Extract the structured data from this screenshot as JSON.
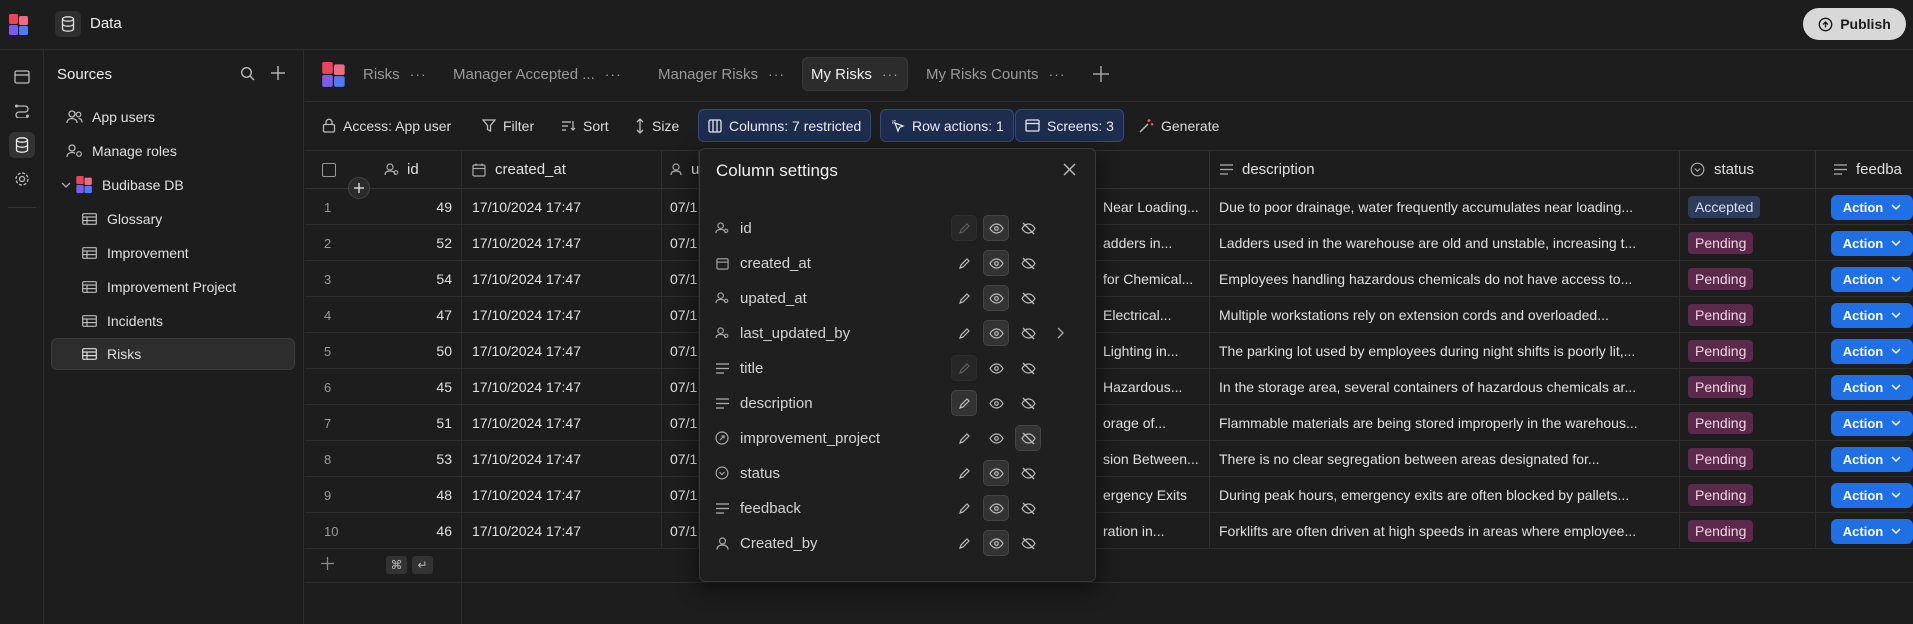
{
  "app": {
    "title": "Data",
    "publish_label": "Publish"
  },
  "sources": {
    "title": "Sources",
    "items": [
      {
        "label": "App users",
        "icon": "users-icon"
      },
      {
        "label": "Manage roles",
        "icon": "user-cog-icon"
      },
      {
        "label": "Budibase DB",
        "icon": "budibase-db-icon"
      },
      {
        "label": "Glossary",
        "icon": "table-icon"
      },
      {
        "label": "Improvement",
        "icon": "table-icon"
      },
      {
        "label": "Improvement Project",
        "icon": "table-icon"
      },
      {
        "label": "Incidents",
        "icon": "table-icon"
      },
      {
        "label": "Risks",
        "icon": "table-icon",
        "active": true
      }
    ]
  },
  "views": {
    "tabs": [
      {
        "label": "Risks"
      },
      {
        "label": "Manager Accepted ..."
      },
      {
        "label": "Manager Risks"
      },
      {
        "label": "My Risks",
        "active": true
      },
      {
        "label": "My Risks Counts"
      }
    ]
  },
  "toolbar": {
    "access": "Access: App user",
    "filter": "Filter",
    "sort": "Sort",
    "size": "Size",
    "columns": "Columns: 7 restricted",
    "row_actions": "Row actions: 1",
    "screens": "Screens: 3",
    "generate": "Generate"
  },
  "grid": {
    "columns": [
      "id",
      "created_at",
      "u",
      "description",
      "status",
      "feedba"
    ],
    "rows": [
      {
        "n": "1",
        "id": "49",
        "created_at": "17/10/2024 17:47",
        "u": "07/1",
        "title": "Near Loading...",
        "description": "Due to poor drainage, water frequently accumulates near loading...",
        "status": "Accepted"
      },
      {
        "n": "2",
        "id": "52",
        "created_at": "17/10/2024 17:47",
        "u": "07/1",
        "title": "adders in...",
        "description": "Ladders used in the warehouse are old and unstable, increasing t...",
        "status": "Pending"
      },
      {
        "n": "3",
        "id": "54",
        "created_at": "17/10/2024 17:47",
        "u": "07/1",
        "title": "for Chemical...",
        "description": "Employees handling hazardous chemicals do not have access to...",
        "status": "Pending"
      },
      {
        "n": "4",
        "id": "47",
        "created_at": "17/10/2024 17:47",
        "u": "07/1",
        "title": "Electrical...",
        "description": "Multiple workstations rely on extension cords and overloaded...",
        "status": "Pending"
      },
      {
        "n": "5",
        "id": "50",
        "created_at": "17/10/2024 17:47",
        "u": "07/1",
        "title": "Lighting in...",
        "description": "The parking lot used by employees during night shifts is poorly lit,...",
        "status": "Pending"
      },
      {
        "n": "6",
        "id": "45",
        "created_at": "17/10/2024 17:47",
        "u": "07/1",
        "title": "Hazardous...",
        "description": "In the storage area, several containers of hazardous chemicals ar...",
        "status": "Pending"
      },
      {
        "n": "7",
        "id": "51",
        "created_at": "17/10/2024 17:47",
        "u": "07/1",
        "title": "orage of...",
        "description": "Flammable materials are being stored improperly in the warehous...",
        "status": "Pending"
      },
      {
        "n": "8",
        "id": "53",
        "created_at": "17/10/2024 17:47",
        "u": "07/1",
        "title": "sion Between...",
        "description": "There is no clear segregation between areas designated for...",
        "status": "Pending"
      },
      {
        "n": "9",
        "id": "48",
        "created_at": "17/10/2024 17:47",
        "u": "07/1",
        "title": "ergency Exits",
        "description": "During peak hours, emergency exits are often blocked by pallets...",
        "status": "Pending"
      },
      {
        "n": "10",
        "id": "46",
        "created_at": "17/10/2024 17:47",
        "u": "07/1",
        "title": "ration in...",
        "description": "Forklifts are often driven at high speeds in areas where employee...",
        "status": "Pending"
      }
    ],
    "action_label": "Action",
    "shortcut_keys": [
      "⌘",
      "↵"
    ]
  },
  "column_settings": {
    "title": "Column settings",
    "columns": [
      {
        "name": "id",
        "icon": "user-icon",
        "state": "read"
      },
      {
        "name": "created_at",
        "icon": "calendar-icon",
        "state": "read"
      },
      {
        "name": "upated_at",
        "icon": "user-icon",
        "state": "read"
      },
      {
        "name": "last_updated_by",
        "icon": "user-icon",
        "state": "read",
        "expand": true
      },
      {
        "name": "title",
        "icon": "text-icon",
        "state": "none"
      },
      {
        "name": "description",
        "icon": "text-icon",
        "state": "write"
      },
      {
        "name": "improvement_project",
        "icon": "link-icon",
        "state": "hidden"
      },
      {
        "name": "status",
        "icon": "options-icon",
        "state": "read"
      },
      {
        "name": "feedback",
        "icon": "text-icon",
        "state": "read"
      },
      {
        "name": "Created_by",
        "icon": "person-icon",
        "state": "read"
      }
    ]
  },
  "colors": {
    "accent": "#1f6fe5",
    "pending_bg": "#5b2a4a",
    "accepted_bg": "#2d3c5a",
    "highlight_btn": "#1e2c4e"
  }
}
